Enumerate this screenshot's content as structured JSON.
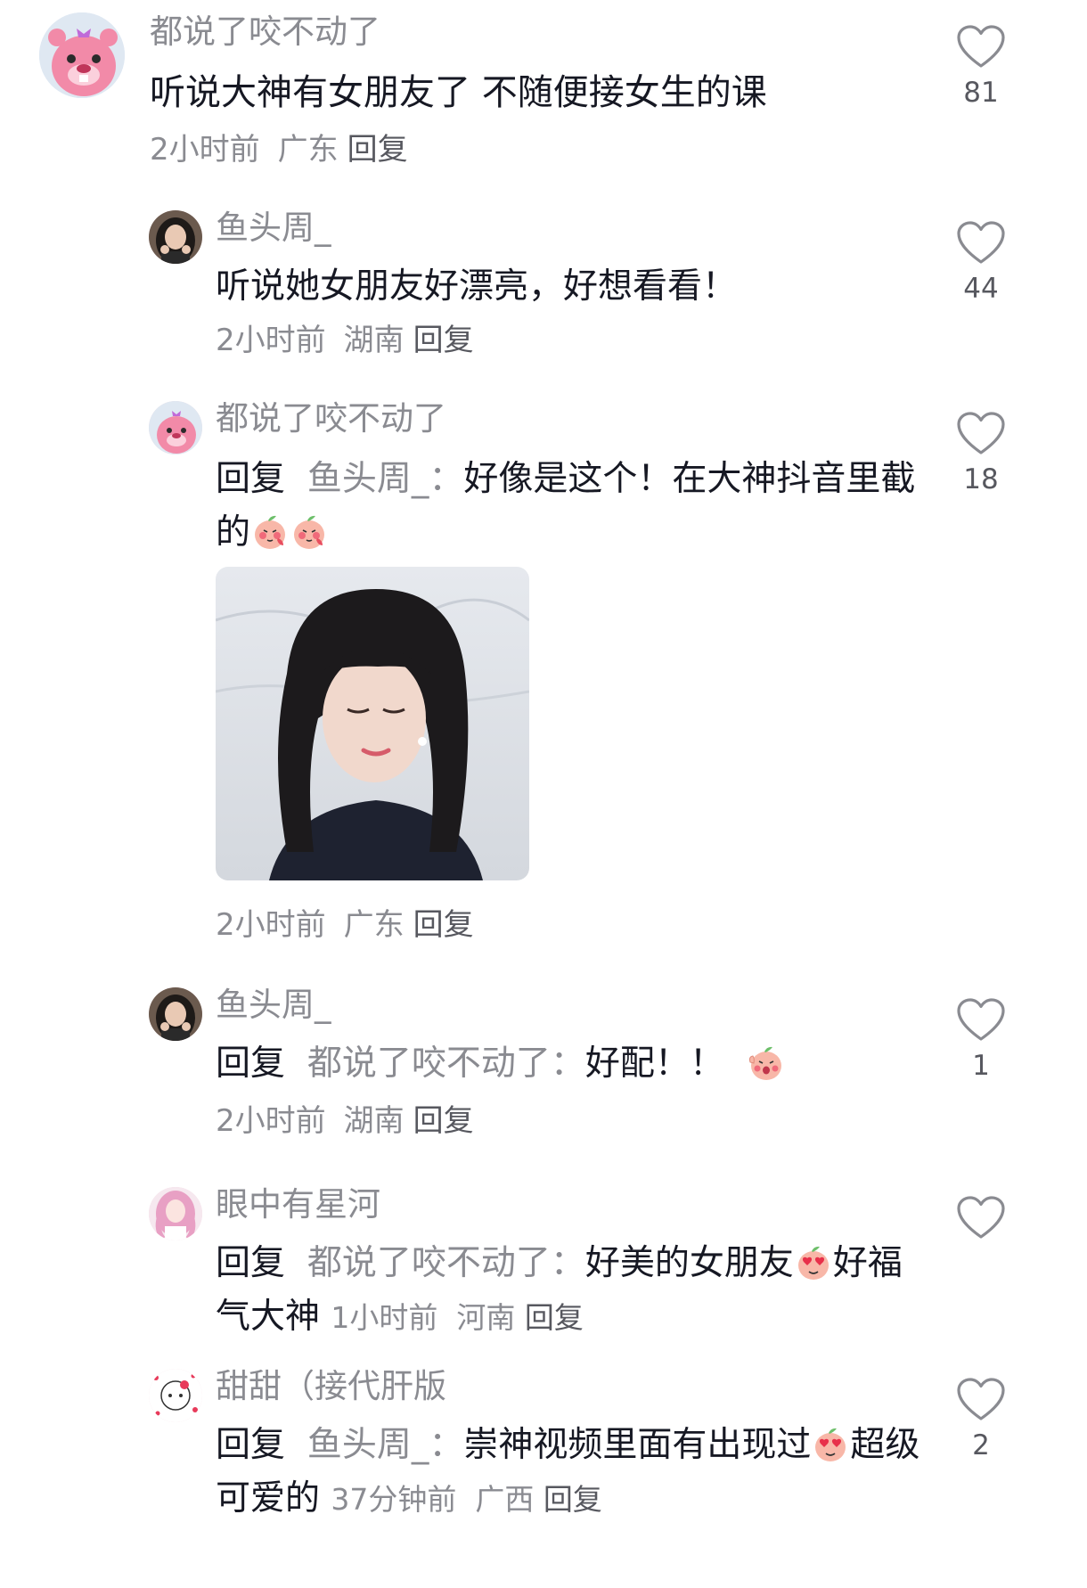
{
  "comments": [
    {
      "name": "都说了咬不动了",
      "text": "听说大神有女朋友了 不随便接女生的课",
      "time": "2小时前",
      "region": "广东",
      "reply_label": "回复",
      "likes": "81"
    },
    {
      "name": "鱼头周_",
      "text": "听说她女朋友好漂亮，好想看看！",
      "time": "2小时前",
      "region": "湖南",
      "reply_label": "回复",
      "likes": "44"
    },
    {
      "name": "都说了咬不动了",
      "prefix": "回复",
      "target": "鱼头周_：",
      "text": "好像是这个！在大神抖音里截的",
      "time": "2小时前",
      "region": "广东",
      "reply_label": "回复",
      "likes": "18"
    },
    {
      "name": "鱼头周_",
      "prefix": "回复",
      "target": "都说了咬不动了：",
      "text": "好配！！",
      "time": "2小时前",
      "region": "湖南",
      "reply_label": "回复",
      "likes": "1"
    },
    {
      "name": "眼中有星河",
      "prefix": "回复",
      "target": "都说了咬不动了：",
      "text_a": "好美的女朋友",
      "text_b": "好福气大神",
      "time": "1小时前",
      "region": "河南",
      "reply_label": "回复",
      "likes": ""
    },
    {
      "name": "甜甜（接代肝版",
      "prefix": "回复",
      "target": "鱼头周_：",
      "text_a": "崇神视频里面有出现过",
      "text_b": "超级可爱的",
      "time": "37分钟前",
      "region": "广西",
      "reply_label": "回复",
      "likes": "2"
    }
  ],
  "icons": {
    "like": "heart-outline-icon",
    "emoji_blush": "peach-blush-emoji",
    "emoji_cheer": "peach-cheer-emoji",
    "emoji_love": "peach-heart-eyes-emoji"
  },
  "colors": {
    "text_primary": "#161823",
    "text_secondary": "#8a8b91",
    "background": "#ffffff"
  }
}
